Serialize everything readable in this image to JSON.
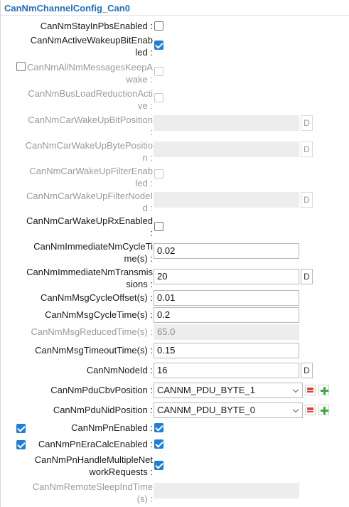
{
  "title": "CanNmChannelConfig_Can0",
  "fields": {
    "stay_in_pbs": {
      "label": "CanNmStayInPbsEnabled :",
      "checked": false
    },
    "active_wakeup": {
      "label": "CanNmActiveWakeupBitEnabled :",
      "checked": true
    },
    "all_nm_keep_awake": {
      "label": "CanNmAllNmMessagesKeepAwake :",
      "checked": false,
      "left_checked": false
    },
    "busload_reduction": {
      "label": "CanNmBusLoadReductionActive :",
      "checked": false
    },
    "car_wakeup_bit_pos": {
      "label": "CanNmCarWakeUpBitPosition :",
      "value": "",
      "button": "D"
    },
    "car_wakeup_byte_pos": {
      "label": "CanNmCarWakeUpBytePosition :",
      "value": "",
      "button": "D"
    },
    "car_wakeup_filter_enabled": {
      "label": "CanNmCarWakeUpFilterEnabled :",
      "checked": false
    },
    "car_wakeup_filter_nodeid": {
      "label": "CanNmCarWakeUpFilterNodeId :",
      "value": "",
      "button": "D"
    },
    "car_wakeup_rx": {
      "label": "CanNmCarWakeUpRxEnabled :",
      "checked": false
    },
    "immediate_cycle_time": {
      "label": "CanNmImmediateNmCycleTime(s) :",
      "value": "0.02"
    },
    "immediate_transmissions": {
      "label": "CanNmImmediateNmTransmissions :",
      "value": "20",
      "button": "D"
    },
    "msg_cycle_offset": {
      "label": "CanNmMsgCycleOffset(s) :",
      "value": "0.01"
    },
    "msg_cycle_time": {
      "label": "CanNmMsgCycleTime(s) :",
      "value": "0.2"
    },
    "msg_reduced_time": {
      "label": "CanNmMsgReducedTime(s) :",
      "value": "65.0"
    },
    "msg_timeout_time": {
      "label": "CanNmMsgTimeoutTime(s) :",
      "value": "0.15"
    },
    "node_id": {
      "label": "CanNmNodeId :",
      "value": "16",
      "button": "D"
    },
    "pdu_cbv_position": {
      "label": "CanNmPduCbvPosition :",
      "value": "CANNM_PDU_BYTE_1"
    },
    "pdu_nid_position": {
      "label": "CanNmPduNidPosition :",
      "value": "CANNM_PDU_BYTE_0"
    },
    "pn_enabled": {
      "label": "CanNmPnEnabled :",
      "checked": true,
      "left_checked": true
    },
    "pn_era_calc": {
      "label": "CanNmPnEraCalcEnabled :",
      "checked": true,
      "left_checked": true
    },
    "pn_handle_multiple": {
      "label": "CanNmPnHandleMultipleNetworkRequests :",
      "checked": true
    },
    "remote_sleep_ind_time": {
      "label": "CanNmRemoteSleepIndTime(s) :",
      "value": ""
    }
  },
  "colors": {
    "accent": "#1e7fd6",
    "title": "#1f6fc6",
    "list_icon": "#e0453a",
    "plus_icon": "#3ea83a"
  }
}
